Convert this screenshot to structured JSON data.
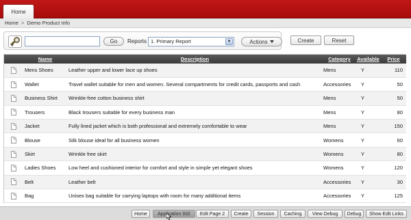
{
  "header": {
    "tab_home": "Home"
  },
  "breadcrumb": {
    "home": "Home",
    "separator": ">",
    "current": "Demo Product Info"
  },
  "toolbar": {
    "search_value": "",
    "go_label": "Go",
    "reports_label": "Reports",
    "report_selected": "1. Primary Report",
    "actions_label": "Actions",
    "create_label": "Create",
    "reset_label": "Reset"
  },
  "table": {
    "headers": {
      "name": "Name",
      "description": "Description",
      "category": "Category",
      "available": "Available",
      "price": "Price"
    },
    "rows": [
      {
        "name": "Mens Shoes",
        "description": "Leather upper and lower lace up shoes",
        "category": "Mens",
        "available": "Y",
        "price": "110"
      },
      {
        "name": "Wallet",
        "description": "Travel wallet suitable for men and women. Several compartments for credit cards, passports and cash",
        "category": "Accessories",
        "available": "Y",
        "price": "50"
      },
      {
        "name": "Business Shirt",
        "description": "Wrinkle-free cotton business shirt",
        "category": "Mens",
        "available": "Y",
        "price": "50"
      },
      {
        "name": "Trousers",
        "description": "Black trousers suitable for every business man",
        "category": "Mens",
        "available": "Y",
        "price": "80"
      },
      {
        "name": "Jacket",
        "description": "Fully lined jacket which is both professional and extremely comfortable to wear",
        "category": "Mens",
        "available": "Y",
        "price": "150"
      },
      {
        "name": "Blouse",
        "description": "Silk blouse ideal for all business women",
        "category": "Womens",
        "available": "Y",
        "price": "60"
      },
      {
        "name": "Skirt",
        "description": "Wrinkle free skirt",
        "category": "Womens",
        "available": "Y",
        "price": "80"
      },
      {
        "name": "Ladies Shoes",
        "description": "Low heel and cushioned interior for comfort and style in simple yet elegant shoes",
        "category": "Womens",
        "available": "Y",
        "price": "120"
      },
      {
        "name": "Belt",
        "description": "Leather belt",
        "category": "Accessories",
        "available": "Y",
        "price": "30"
      },
      {
        "name": "Bag",
        "description": "Unisex bag suitable for carrying laptops with room for many additional items",
        "category": "Accessories",
        "available": "Y",
        "price": "125"
      }
    ]
  },
  "devbar": {
    "buttons": [
      "Home",
      "Application 932",
      "Edit Page 2",
      "Create",
      "Session",
      "Caching",
      "View Debug",
      "Debug",
      "Show Edit Links"
    ]
  },
  "colors": {
    "header_red": "#b31212",
    "table_header": "#444444"
  }
}
